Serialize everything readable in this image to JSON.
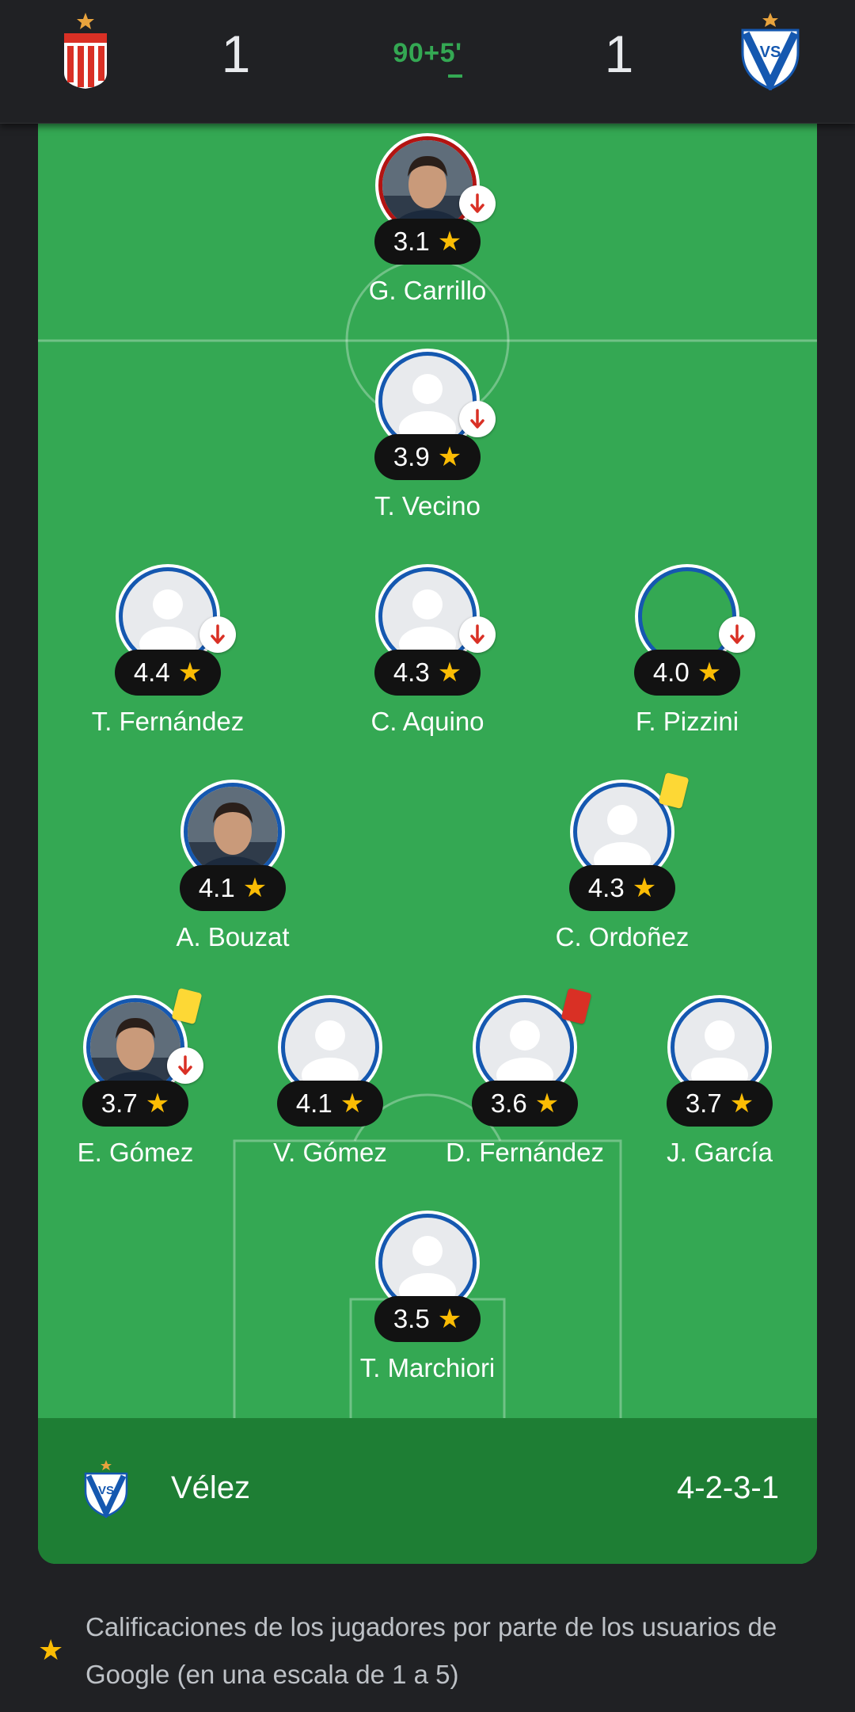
{
  "match": {
    "home_score": "1",
    "away_score": "1",
    "clock": "90+5'"
  },
  "colors": {
    "pitch": "#34a853",
    "team_bar": "#1e7e34",
    "rating_star": "#fbbc04",
    "sub_arrow": "#d93025",
    "avatar_border": "#1558b0",
    "yellow_card": "#fdd835",
    "red_card": "#d93025"
  },
  "players": [
    {
      "name": "G. Carrillo",
      "rating": "3.1",
      "icon": "player-photo",
      "substituted": true,
      "card": null
    },
    {
      "name": "T. Vecino",
      "rating": "3.9",
      "icon": "person-icon",
      "substituted": true,
      "card": null
    },
    {
      "name": "T. Fernández",
      "rating": "4.4",
      "icon": "person-icon",
      "substituted": true,
      "card": null
    },
    {
      "name": "C. Aquino",
      "rating": "4.3",
      "icon": "person-icon",
      "substituted": true,
      "card": null
    },
    {
      "name": "F. Pizzini",
      "rating": "4.0",
      "icon": "empty-avatar",
      "substituted": true,
      "card": null
    },
    {
      "name": "A. Bouzat",
      "rating": "4.1",
      "icon": "player-photo",
      "substituted": false,
      "card": null
    },
    {
      "name": "C. Ordoñez",
      "rating": "4.3",
      "icon": "person-icon",
      "substituted": false,
      "card": "yellow"
    },
    {
      "name": "E. Gómez",
      "rating": "3.7",
      "icon": "player-photo",
      "substituted": true,
      "card": "yellow"
    },
    {
      "name": "V. Gómez",
      "rating": "4.1",
      "icon": "person-icon",
      "substituted": false,
      "card": null
    },
    {
      "name": "D. Fernández",
      "rating": "3.6",
      "icon": "person-icon",
      "substituted": false,
      "card": "red"
    },
    {
      "name": "J. García",
      "rating": "3.7",
      "icon": "person-icon",
      "substituted": false,
      "card": null
    },
    {
      "name": "T. Marchiori",
      "rating": "3.5",
      "icon": "person-icon",
      "substituted": false,
      "card": null
    }
  ],
  "team": {
    "name": "Vélez",
    "formation": "4-2-3-1"
  },
  "footnote": "Calificaciones de los jugadores por parte de los usuarios de Google (en una escala de 1 a 5)"
}
